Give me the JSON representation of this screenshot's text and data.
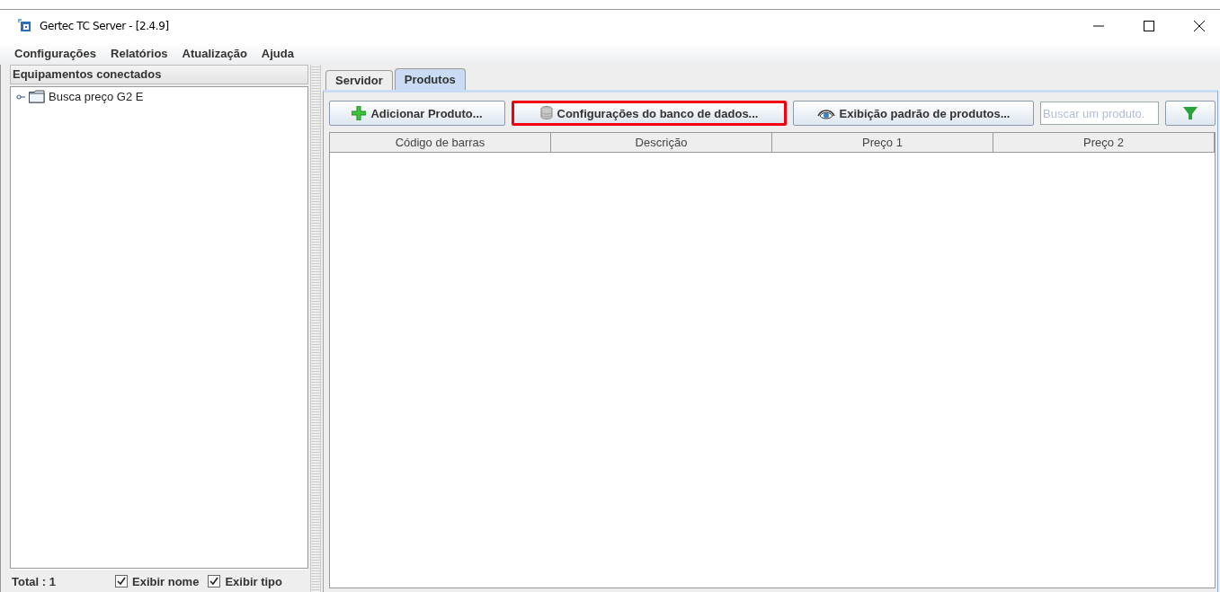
{
  "window": {
    "title": "Gertec TC Server - [2.4.9]"
  },
  "menu": [
    "Configurações",
    "Relatórios",
    "Atualização",
    "Ajuda"
  ],
  "sidebar": {
    "title": "Equipamentos conectados",
    "items": [
      {
        "label": "Busca preço G2 E"
      }
    ],
    "total": "Total : 1",
    "options": [
      {
        "label": "Exibir nome",
        "checked": true
      },
      {
        "label": "Exibir tipo",
        "checked": true
      }
    ]
  },
  "tabs": [
    {
      "label": "Servidor",
      "selected": false
    },
    {
      "label": "Produtos",
      "selected": true
    }
  ],
  "toolbar": {
    "buttons": [
      {
        "kind": "add",
        "label": "Adicionar Produto...",
        "highlighted": false
      },
      {
        "kind": "database",
        "label": "Configurações do banco de dados...",
        "highlighted": true
      },
      {
        "kind": "view",
        "label": "Exibição padrão de produtos...",
        "highlighted": false
      }
    ],
    "search": {
      "placeholder": "Buscar um produto."
    }
  },
  "table": {
    "columns": [
      "Código de barras",
      "Descrição",
      "Preço 1",
      "Preço 2"
    ]
  }
}
